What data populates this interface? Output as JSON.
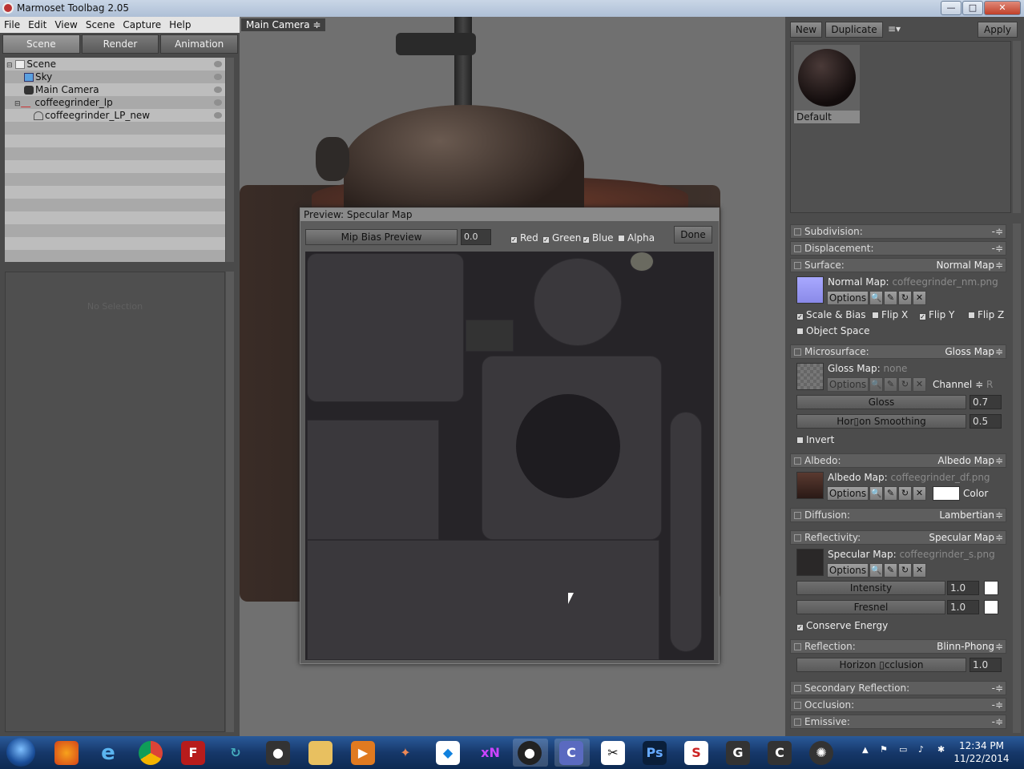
{
  "window": {
    "title": "Marmoset Toolbag 2.05",
    "controls": {
      "minimize": "—",
      "maximize": "□",
      "close": "✕"
    }
  },
  "menu": [
    "File",
    "Edit",
    "View",
    "Scene",
    "Capture",
    "Help"
  ],
  "left_panel": {
    "tabs": [
      "Scene",
      "Render",
      "Animation"
    ],
    "active_tab": "Scene",
    "tree": [
      {
        "label": "Scene",
        "icon": "scene-icon"
      },
      {
        "label": "Sky",
        "icon": "sky-icon"
      },
      {
        "label": "Main Camera",
        "icon": "camera-icon"
      },
      {
        "label": "coffeegrinder_lp",
        "icon": "mesh-icon"
      },
      {
        "label": "coffeegrinder_LP_new",
        "icon": "mesh-child-icon"
      }
    ],
    "no_selection": "No Selection"
  },
  "viewport": {
    "camera_label": "Main Camera ≑"
  },
  "preview_dialog": {
    "title": "Preview: Specular Map",
    "mip_bias_button": "Mip Bias Preview",
    "mip_bias_value": "0.0",
    "channels": [
      {
        "label": "Red",
        "checked": true
      },
      {
        "label": "Green",
        "checked": true
      },
      {
        "label": "Blue",
        "checked": true
      },
      {
        "label": "Alpha",
        "checked": false
      }
    ],
    "done_button": "Done"
  },
  "right_panel": {
    "buttons": {
      "new": "New",
      "duplicate": "Duplicate",
      "menu": "≡▾",
      "apply": "Apply"
    },
    "material_name": "Default",
    "sections": {
      "subdivision": {
        "label": "Subdivision:",
        "value": ""
      },
      "displacement": {
        "label": "Displacement:",
        "value": ""
      },
      "surface": {
        "label": "Surface:",
        "value": "Normal Map"
      },
      "microsurface": {
        "label": "Microsurface:",
        "value": "Gloss Map"
      },
      "albedo": {
        "label": "Albedo:",
        "value": "Albedo Map"
      },
      "diffusion": {
        "label": "Diffusion:",
        "value": "Lambertian"
      },
      "reflectivity": {
        "label": "Reflectivity:",
        "value": "Specular Map"
      },
      "reflection": {
        "label": "Reflection:",
        "value": "Blinn-Phong"
      },
      "secondary_reflection": {
        "label": "Secondary Reflection:",
        "value": ""
      },
      "occlusion": {
        "label": "Occlusion:",
        "value": ""
      },
      "emissive": {
        "label": "Emissive:",
        "value": ""
      }
    },
    "surface": {
      "map_label": "Normal Map:",
      "map_file": "coffeegrinder_nm.png",
      "options": "Options",
      "scale_bias": "Scale & Bias",
      "flip_x": "Flip X",
      "flip_y": "Flip Y",
      "flip_z": "Flip Z",
      "object_space": "Object Space"
    },
    "microsurface": {
      "map_label": "Gloss Map:",
      "map_file": "none",
      "options": "Options",
      "channel_label": "Channel ≑",
      "channel_value": "R",
      "gloss_label": "Gloss",
      "gloss_value": "0.7",
      "horizon_label": "Hor▯on Smoothing",
      "horizon_value": "0.5",
      "invert": "Invert"
    },
    "albedo": {
      "map_label": "Albedo Map:",
      "map_file": "coffeegrinder_df.png",
      "options": "Options",
      "color_label": "Color"
    },
    "reflectivity": {
      "map_label": "Specular Map:",
      "map_file": "coffeegrinder_s.png",
      "options": "Options",
      "intensity_label": "Intensity",
      "intensity_value": "1.0",
      "fresnel_label": "Fresnel",
      "fresnel_value": "1.0",
      "conserve_energy": "Conserve Energy"
    },
    "reflection": {
      "horizon_label": "Horizon ▯cclusion",
      "horizon_value": "1.0"
    }
  },
  "taskbar": {
    "apps": [
      "Firefox",
      "Internet Explorer",
      "Chrome",
      "FileZilla",
      "App",
      "App",
      "Explorer",
      "Media Player",
      "App",
      "Dropbox",
      "App",
      "Marmoset",
      "App",
      "App",
      "Photoshop",
      "Substance",
      "App",
      "App",
      "App"
    ],
    "clock_time": "12:34 PM",
    "clock_date": "11/22/2014"
  },
  "colors": {
    "accent_blue": "#16386a",
    "panel_bg": "#4c4c4c",
    "viewport_bg": "#707070"
  }
}
